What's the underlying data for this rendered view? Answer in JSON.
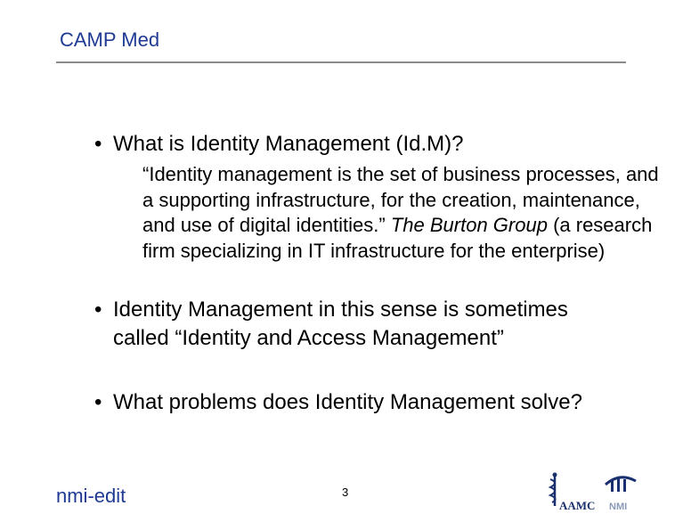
{
  "header": {
    "title": "CAMP Med"
  },
  "bullets": [
    {
      "dot": "•",
      "text": "What is Identity Management (Id.M)?"
    },
    {
      "dot": "•",
      "text": "Identity Management in this sense is sometimes called “Identity and Access Management”"
    },
    {
      "dot": "•",
      "text": "What problems does Identity Management solve?"
    }
  ],
  "quote": {
    "text_before": "“Identity management is the set of business processes, and a supporting infrastructure, for the creation, maintenance, and use of digital identities.” ",
    "source": "The Burton Group",
    "text_after": " (a research firm specializing in IT infrastructure for the enterprise)"
  },
  "footer": {
    "brand": "nmi-edit",
    "page_number": "3",
    "logos": {
      "aamc": {
        "label": "AAMC",
        "icon": "caduceus-icon"
      },
      "nmi": {
        "label": "NMI",
        "icon": "nmi-swoosh-icon"
      }
    }
  },
  "colors": {
    "title_blue": "#1f3a93",
    "rule_gray": "#8a8a8a",
    "logo_navy": "#1a2f6e"
  }
}
